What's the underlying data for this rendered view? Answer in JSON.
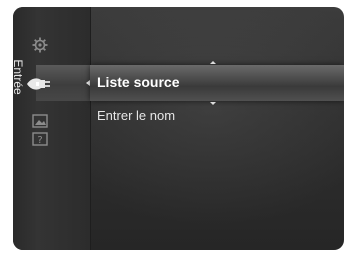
{
  "category": {
    "label": "Entrée"
  },
  "icons": [
    {
      "name": "gear-icon"
    },
    {
      "name": "input-plug-icon"
    },
    {
      "name": "picture-icon"
    },
    {
      "name": "help-icon"
    }
  ],
  "menu": {
    "items": [
      {
        "label": "Liste source",
        "selected": true
      },
      {
        "label": "Entrer le nom",
        "selected": false
      }
    ]
  },
  "colors": {
    "background": "#2f2f2f",
    "highlight": "#4a4a4a",
    "text": "#e6e6e6",
    "selected_text": "#ffffff"
  }
}
